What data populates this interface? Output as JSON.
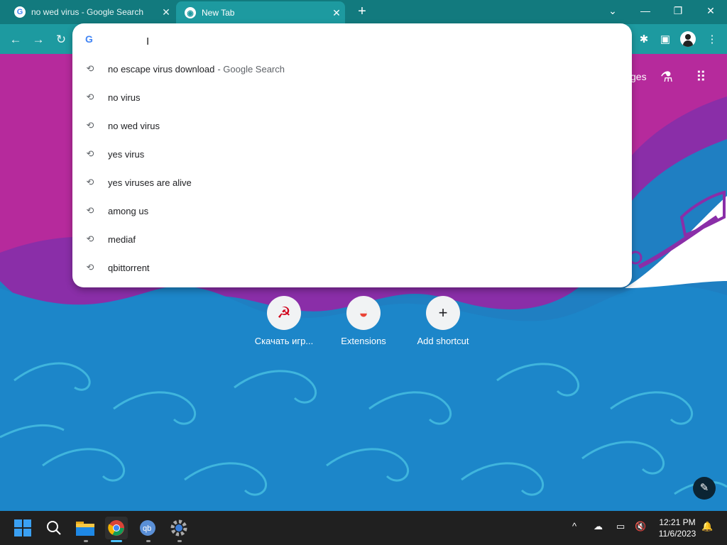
{
  "tabs": [
    {
      "title": "no wed virus - Google Search",
      "favicon": "G",
      "close": "✕"
    },
    {
      "title": "New Tab",
      "favicon": "◉",
      "close": "✕"
    }
  ],
  "new_tab_symbol": "+",
  "window_controls": {
    "tab_search": "⌄",
    "minimize": "—",
    "restore": "❐",
    "close": "✕"
  },
  "nav": {
    "back": "←",
    "forward": "→",
    "reload": "↻"
  },
  "omnibox": {
    "icon_letter": "G",
    "value": "",
    "placeholder": "",
    "suggestions": [
      {
        "text": "no escape virus download",
        "suffix": "- Google Search"
      },
      {
        "text": "no virus",
        "suffix": ""
      },
      {
        "text": "no wed virus",
        "suffix": ""
      },
      {
        "text": "yes virus",
        "suffix": ""
      },
      {
        "text": "yes viruses are alive",
        "suffix": ""
      },
      {
        "text": "among us",
        "suffix": ""
      },
      {
        "text": "mediaf",
        "suffix": ""
      },
      {
        "text": "qbittorrent",
        "suffix": ""
      }
    ],
    "history_icon": "⟲"
  },
  "ntp": {
    "images_partial": "ges",
    "labs_icon": "⚗",
    "apps_icon": "⠿"
  },
  "shortcuts": [
    {
      "label": "Скачать игр...",
      "icon": "☭"
    },
    {
      "label": "Extensions",
      "icon": "◒"
    },
    {
      "label": "Add shortcut",
      "icon": "+"
    }
  ],
  "toolbar_right": {
    "extensions": "✱",
    "sidepanel": "▣",
    "menu": "⋮"
  },
  "edit_icon": "✎",
  "taskbar": {
    "clock_time": "12:21 PM",
    "clock_date": "11/6/2023",
    "tray_chevron": "^",
    "tray_cloud": "☁",
    "tray_network": "▭",
    "tray_volume": "🔇",
    "tray_bell": "🔔"
  },
  "colors": {
    "tabbar": "#127a7e",
    "toolbar": "#1d9aa0",
    "taskbar": "#202020",
    "google_blue": "#4285f4"
  }
}
